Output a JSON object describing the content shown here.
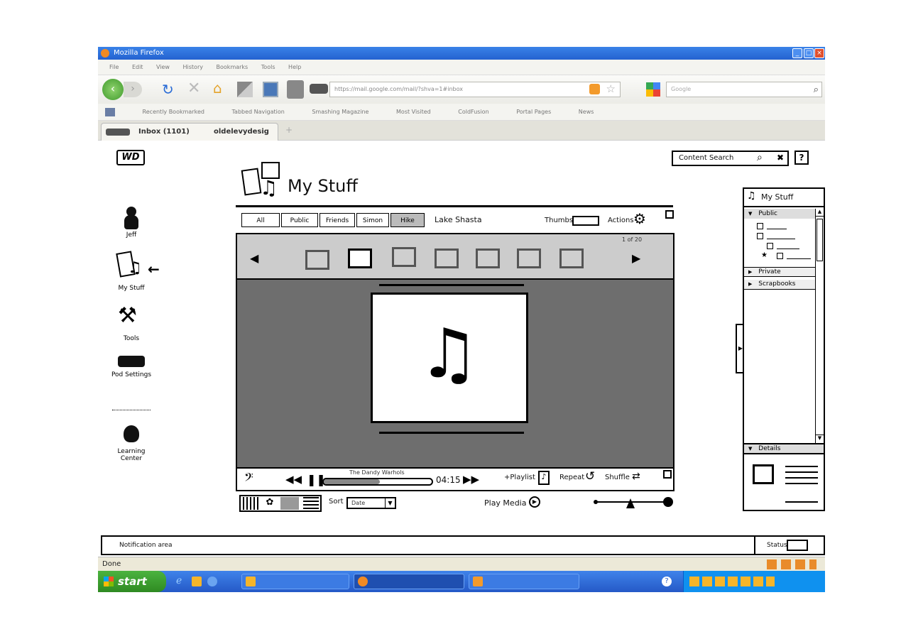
{
  "browser": {
    "window_title": "Mozilla Firefox",
    "menu": [
      "File",
      "Edit",
      "View",
      "History",
      "Bookmarks",
      "Tools",
      "Help"
    ],
    "address": "https://mail.google.com/mail/?shva=1#inbox",
    "search_placeholder": "Google",
    "bookmarks": [
      "Recently Bookmarked",
      "Tabbed Navigation",
      "Smashing Magazine",
      "Most Visited",
      "ColdFusion",
      "Portal Pages",
      "News"
    ],
    "tabs": [
      {
        "label": "Inbox (1101)"
      },
      {
        "label": "oldelevydesig"
      }
    ],
    "status": "Done"
  },
  "app": {
    "logo": "WD",
    "content_search": {
      "placeholder": "Content Search",
      "help": "?"
    },
    "page_title": "My Stuff",
    "left_nav": [
      {
        "label": "Jeff",
        "icon": "user-icon"
      },
      {
        "label": "My Stuff",
        "icon": "my-stuff-icon"
      },
      {
        "label": "Tools",
        "icon": "tools-icon"
      },
      {
        "label": "Pod Settings",
        "icon": "device-icon"
      },
      {
        "label": "Learning Center",
        "icon": "owl-icon"
      }
    ],
    "breadcrumbs": [
      "All",
      "Public",
      "Friends",
      "Simon",
      "Hike"
    ],
    "current_folder": "Lake Shasta",
    "thumbs_label": "Thumbs",
    "actions_label": "Actions",
    "pager": "1 of 20",
    "player": {
      "track": "The Dandy Warhols",
      "time": "04:15",
      "playlist_label": "+Playlist",
      "repeat_label": "Repeat",
      "shuffle_label": "Shuffle",
      "progress": 0.52
    },
    "sort_label": "Sort",
    "sort_value": "Date",
    "play_media_label": "Play Media",
    "sidebar": {
      "title": "My Stuff",
      "sections": [
        "Public",
        "Private",
        "Scrapbooks"
      ],
      "details_label": "Details"
    },
    "notification": "Notification area",
    "status_label": "Status"
  },
  "taskbar": {
    "start_label": "start"
  }
}
